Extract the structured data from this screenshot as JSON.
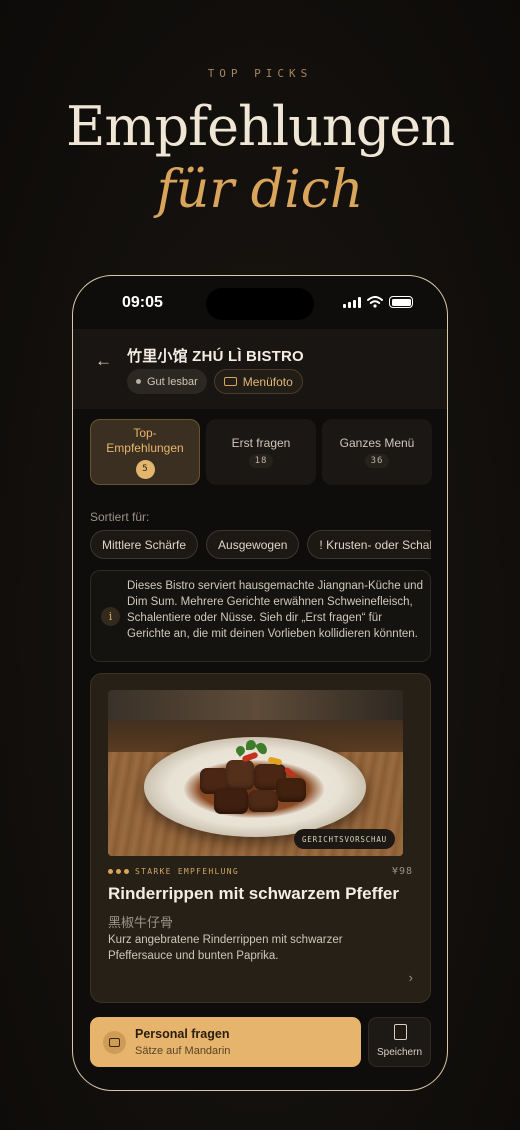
{
  "hero": {
    "eyebrow": "TOP PICKS",
    "title": "Empfehlungen",
    "subtitle": "für dich"
  },
  "status_bar": {
    "time": "09:05",
    "icons": [
      "signal-icon",
      "wifi-icon",
      "battery-icon"
    ]
  },
  "header": {
    "back_icon": "arrow-left-icon",
    "restaurant_name": "竹里小馆 ZHÚ LÌ BISTRO",
    "readability_tag": "Gut lesbar",
    "menu_photo_label": "Menüfoto"
  },
  "tabs": [
    {
      "label": "Top-\nEmpfehlungen",
      "count": "5",
      "active": true
    },
    {
      "label": "Erst fragen",
      "count": "18",
      "active": false
    },
    {
      "label": "Ganzes Menü",
      "count": "36",
      "active": false
    }
  ],
  "sort": {
    "label": "Sortiert für:",
    "chips": [
      "Mittlere Schärfe",
      "Ausgewogen",
      "! Krusten- oder Schalen"
    ]
  },
  "info_banner": {
    "icon": "i",
    "text": "Dieses Bistro serviert hausgemachte Jiangnan-Küche und Dim Sum. Mehrere Gerichte erwähnen Schweinefleisch, Schalentiere oder Nüsse. Sieh dir „Erst fragen“ für Gerichte an, die mit deinen Vorlieben kollidieren könnten."
  },
  "dish_card": {
    "photo_badge": "GERICHTSVORSCHAU",
    "recommendation_label": "STARKE EMPFEHLUNG",
    "price": "¥98",
    "name": "Rinderrippen mit schwarzem Pfeffer",
    "chinese_name": "黑椒牛仔骨",
    "description": "Kurz angebratene Rinderrippen mit schwarzer Pfeffersauce und bunten Paprika."
  },
  "actions": {
    "ask_title": "Personal fragen",
    "ask_subtitle": "Sätze auf Mandarin",
    "save_label": "Speichern"
  },
  "colors": {
    "accent": "#e6b46d",
    "background": "#0f0d0b"
  }
}
